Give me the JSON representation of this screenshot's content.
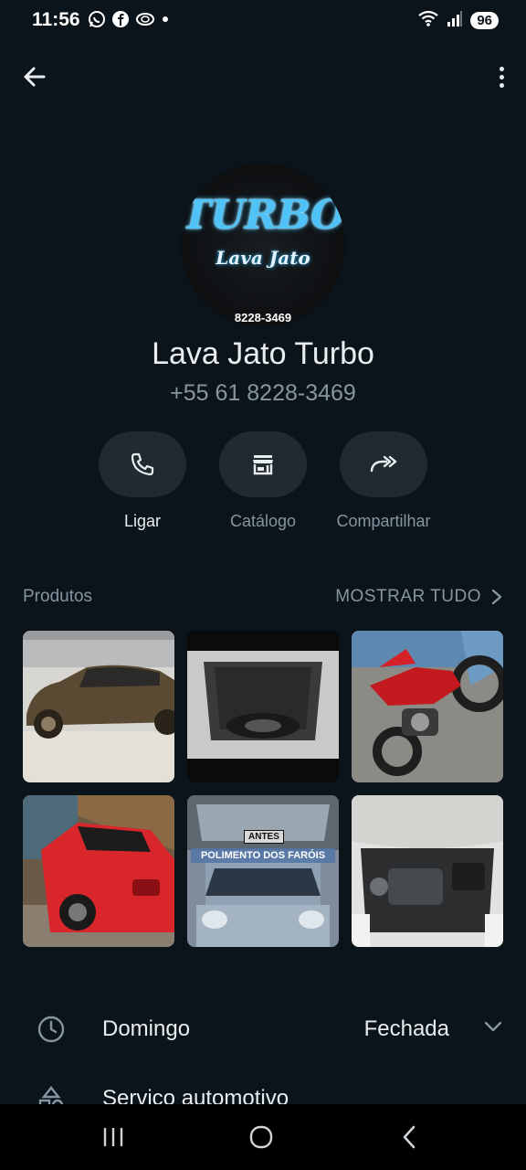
{
  "status_bar": {
    "time": "11:56",
    "battery": "96",
    "left_icons": [
      "whatsapp-icon",
      "facebook-icon",
      "sync-icon",
      "dot-icon"
    ],
    "right_icons": [
      "wifi-icon",
      "signal-icon",
      "battery-icon"
    ]
  },
  "top_bar": {
    "back_icon": "arrow-left-icon",
    "menu_icon": "more-vertical-icon"
  },
  "profile": {
    "avatar_brand": "TURBO",
    "avatar_sub": "Lava Jato",
    "avatar_phone": "8228-3469",
    "name": "Lava Jato Turbo",
    "phone": "+55 61 8228-3469"
  },
  "actions": [
    {
      "label": "Ligar",
      "icon": "phone-icon"
    },
    {
      "label": "Catálogo",
      "icon": "store-icon"
    },
    {
      "label": "Compartilhar",
      "icon": "share-icon"
    }
  ],
  "products": {
    "title": "Produtos",
    "show_all": "MOSTRAR TUDO",
    "items": [
      {
        "image": "muddy-sedan"
      },
      {
        "image": "car-trunk-interior"
      },
      {
        "image": "red-motorcycle"
      },
      {
        "image": "red-suv"
      },
      {
        "image": "headlight-polish",
        "badge": "ANTES",
        "caption": "POLIMENTO DOS FARÓIS"
      },
      {
        "image": "engine-bay"
      }
    ]
  },
  "hours": {
    "day": "Domingo",
    "status": "Fechada"
  },
  "category": {
    "label": "Serviço automotivo"
  },
  "colors": {
    "background": "#0b141a",
    "pill": "#1f2a31",
    "secondary_text": "#8696a0",
    "primary_text": "#e9edef"
  }
}
